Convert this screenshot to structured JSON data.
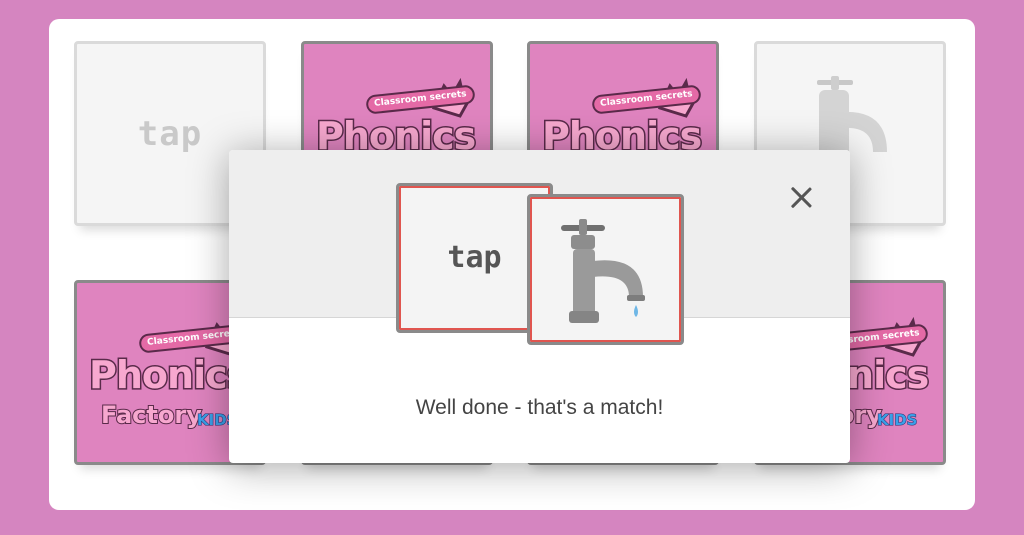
{
  "game": {
    "cards": [
      {
        "id": "card-1",
        "state": "matched",
        "word": "tap"
      },
      {
        "id": "card-2",
        "state": "face-down"
      },
      {
        "id": "card-3",
        "state": "face-down"
      },
      {
        "id": "card-4",
        "state": "matched",
        "picture": "tap-faucet"
      },
      {
        "id": "card-5",
        "state": "face-down"
      },
      {
        "id": "card-6",
        "state": "face-down"
      },
      {
        "id": "card-7",
        "state": "face-down"
      },
      {
        "id": "card-8",
        "state": "face-down"
      }
    ],
    "card_back": {
      "brand_small": "Classroom secrets",
      "brand_main": "Phonics",
      "brand_sub": "Factory",
      "brand_kids": "KIDS"
    }
  },
  "modal": {
    "word_card": "tap",
    "picture_card_icon": "tap-faucet-icon",
    "message": "Well done - that's a match!",
    "close_icon": "close-icon"
  },
  "colors": {
    "background": "#d585c0",
    "card_back": "#df84bf",
    "match_highlight": "#e0554f"
  }
}
